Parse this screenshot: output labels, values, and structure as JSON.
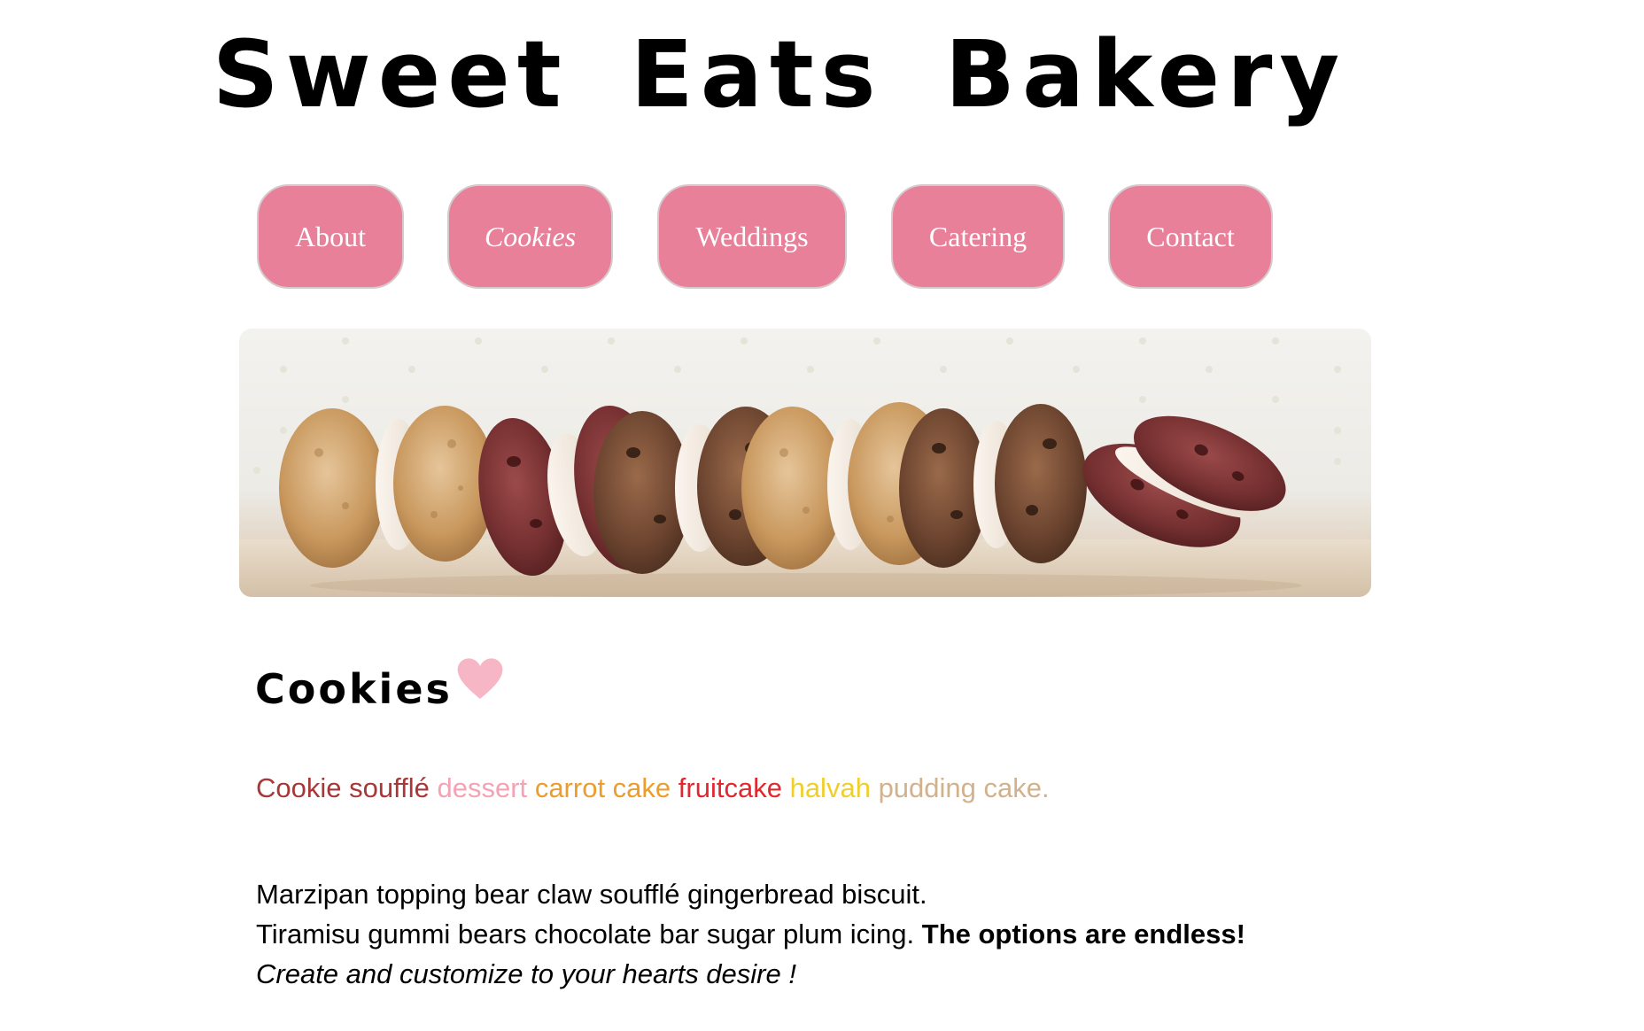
{
  "header": {
    "title": "Sweet Eats Bakery"
  },
  "nav": {
    "items": [
      {
        "label": "About",
        "active": false
      },
      {
        "label": "Cookies",
        "active": true
      },
      {
        "label": "Weddings",
        "active": false
      },
      {
        "label": "Catering",
        "active": false
      },
      {
        "label": "Contact",
        "active": false
      }
    ]
  },
  "hero": {
    "icon": "cookies-photo"
  },
  "main": {
    "section_title": "Cookies",
    "heart_color": "#f7b6c6",
    "flavors": [
      {
        "text": "Cookie soufflé",
        "color": "#a83838"
      },
      {
        "text": "dessert",
        "color": "#f4a3b5"
      },
      {
        "text": "carrot cake",
        "color": "#eb9d2e"
      },
      {
        "text": "fruitcake",
        "color": "#e0282e"
      },
      {
        "text": "halvah",
        "color": "#f0cf2a"
      },
      {
        "text": "pudding cake.",
        "color": "#d2b28c"
      }
    ],
    "description": {
      "line1": "Marzipan topping bear claw soufflé gingerbread biscuit.",
      "line2_regular": "Tiramisu gummi bears chocolate bar sugar plum icing. ",
      "line2_bold": "The options are endless!",
      "line3_italic": "Create and customize to your hearts desire !"
    }
  },
  "theme": {
    "nav_button_color": "#e9809a",
    "nav_text_color": "#ffffff"
  }
}
